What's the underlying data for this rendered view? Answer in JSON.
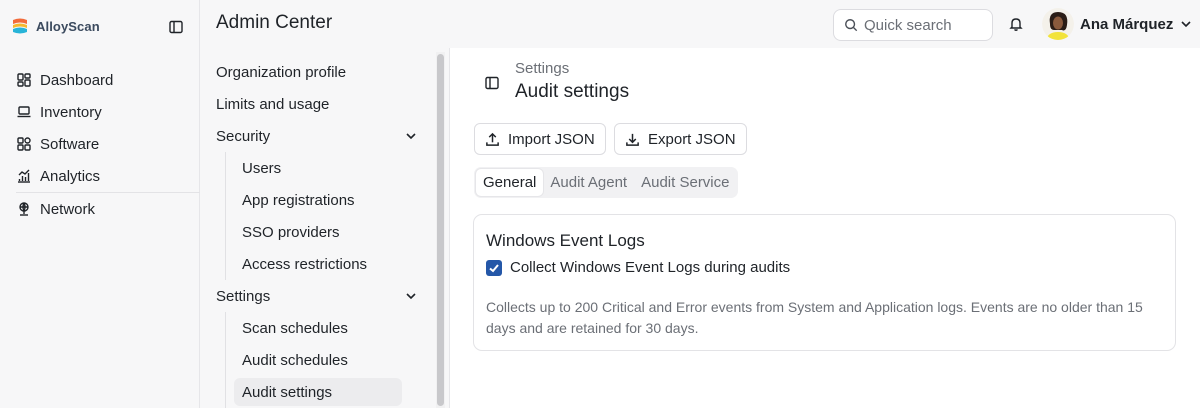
{
  "brand": {
    "name": "AlloyScan"
  },
  "sidebar": {
    "items": [
      {
        "label": "Dashboard",
        "icon": "dashboard-icon"
      },
      {
        "label": "Inventory",
        "icon": "laptop-icon"
      },
      {
        "label": "Software",
        "icon": "apps-icon"
      },
      {
        "label": "Analytics",
        "icon": "analytics-icon"
      },
      {
        "label": "Network",
        "icon": "network-icon"
      }
    ]
  },
  "header": {
    "title": "Admin Center",
    "search_placeholder": "Quick search",
    "user_name": "Ana Márquez"
  },
  "subnav": {
    "org_profile": "Organization profile",
    "limits": "Limits and usage",
    "security": {
      "label": "Security",
      "children": [
        "Users",
        "App registrations",
        "SSO providers",
        "Access restrictions"
      ]
    },
    "settings": {
      "label": "Settings",
      "children": [
        "Scan schedules",
        "Audit schedules",
        "Audit settings"
      ]
    }
  },
  "content": {
    "breadcrumb": "Settings",
    "title": "Audit settings",
    "import_label": "Import JSON",
    "export_label": "Export JSON",
    "tabs": [
      "General",
      "Audit Agent",
      "Audit Service"
    ],
    "active_tab": "General",
    "card": {
      "title": "Windows Event Logs",
      "checkbox_label": "Collect Windows Event Logs during audits",
      "checked": true,
      "description": "Collects up to 200 Critical and Error events from System and Application logs. Events are no older than 15 days and are retained for 30 days."
    }
  },
  "colors": {
    "accent": "#2457a8",
    "brand_gradient": [
      "#f26b3a",
      "#f5b82e",
      "#28b4d8"
    ]
  }
}
